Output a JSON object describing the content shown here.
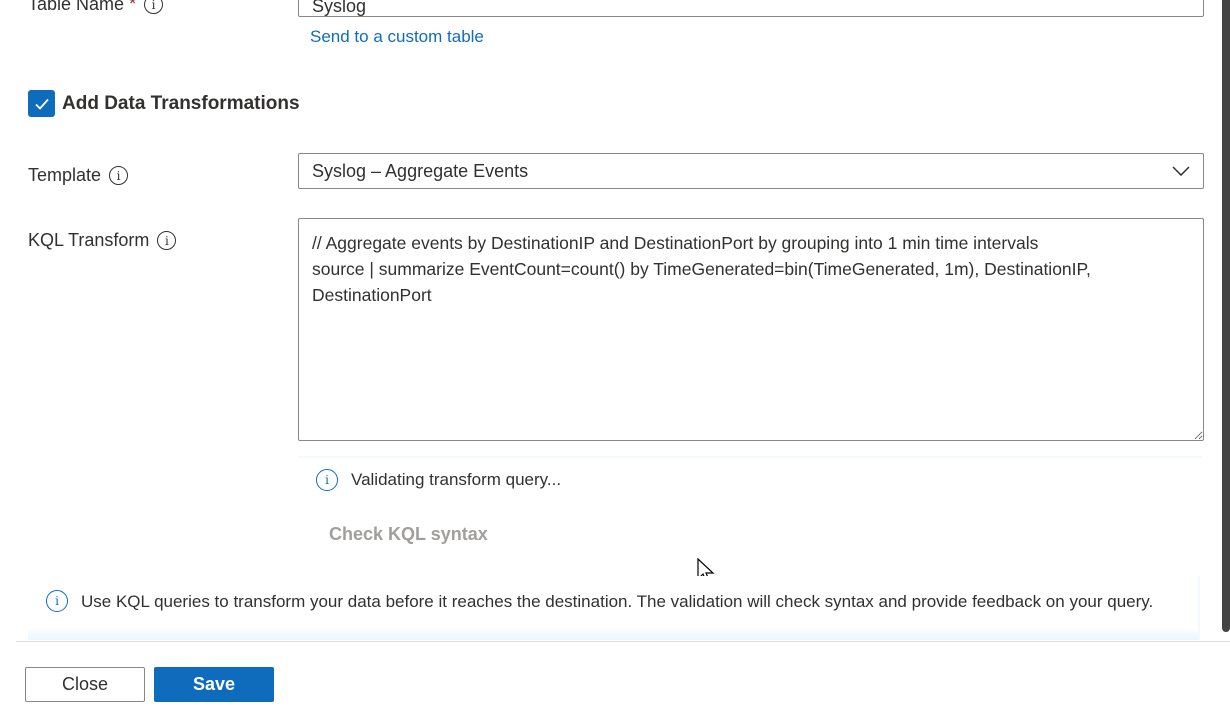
{
  "table_name": {
    "label": "Table Name",
    "required_mark": "*",
    "value": "Syslog",
    "custom_link": "Send to a custom table"
  },
  "transformations": {
    "label": "Add Data Transformations",
    "checked": true
  },
  "template": {
    "label": "Template",
    "value": "Syslog – Aggregate Events"
  },
  "kql": {
    "label": "KQL Transform",
    "value": "// Aggregate events by DestinationIP and DestinationPort by grouping into 1 min time intervals\nsource | summarize EventCount=count() by TimeGenerated=bin(TimeGenerated, 1m), DestinationIP, DestinationPort"
  },
  "validation": {
    "message": "Validating transform query...",
    "check_button": "Check KQL syntax"
  },
  "info_banner": {
    "message": "Use KQL queries to transform your data before it reaches the destination. The validation will check syntax and provide feedback on your query."
  },
  "footer": {
    "close": "Close",
    "save": "Save"
  },
  "colors": {
    "accent": "#0f6cbd"
  }
}
